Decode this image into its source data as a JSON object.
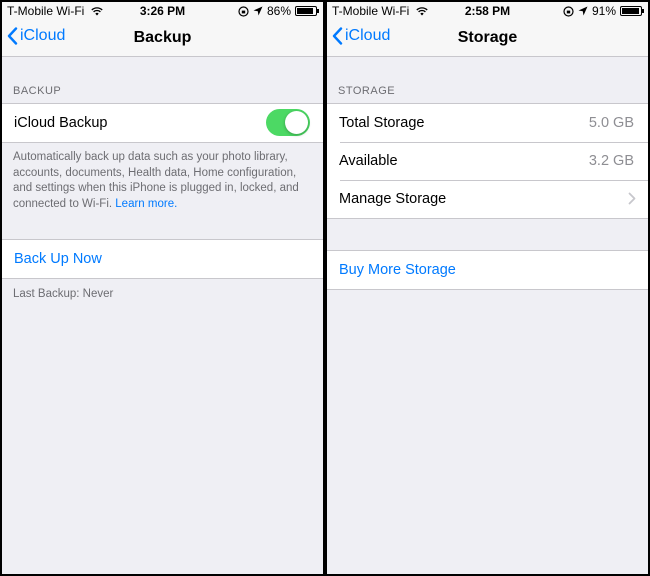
{
  "left": {
    "status": {
      "carrier": "T-Mobile Wi-Fi",
      "time": "3:26 PM",
      "battery": "86%",
      "battery_level": 0.86
    },
    "nav": {
      "back": "iCloud",
      "title": "Backup"
    },
    "section_header": "BACKUP",
    "icloud_backup": {
      "label": "iCloud Backup",
      "enabled": true
    },
    "description": "Automatically back up data such as your photo library, accounts, documents, Health data, Home configuration, and settings when this iPhone is plugged in, locked, and connected to Wi-Fi.",
    "learn_more": "Learn more.",
    "backup_now": "Back Up Now",
    "last_backup": "Last Backup: Never"
  },
  "right": {
    "status": {
      "carrier": "T-Mobile Wi-Fi",
      "time": "2:58 PM",
      "battery": "91%",
      "battery_level": 0.91
    },
    "nav": {
      "back": "iCloud",
      "title": "Storage"
    },
    "section_header": "STORAGE",
    "rows": [
      {
        "label": "Total Storage",
        "value": "5.0 GB"
      },
      {
        "label": "Available",
        "value": "3.2 GB"
      },
      {
        "label": "Manage Storage",
        "value": ""
      }
    ],
    "buy_more": "Buy More Storage"
  },
  "colors": {
    "accent": "#007aff",
    "toggle_on": "#4cd964",
    "background": "#efeff4"
  },
  "icons": [
    "wifi-icon",
    "orientation-lock-icon",
    "location-arrow-icon",
    "battery-icon",
    "chevron-left-icon",
    "chevron-right-icon"
  ]
}
